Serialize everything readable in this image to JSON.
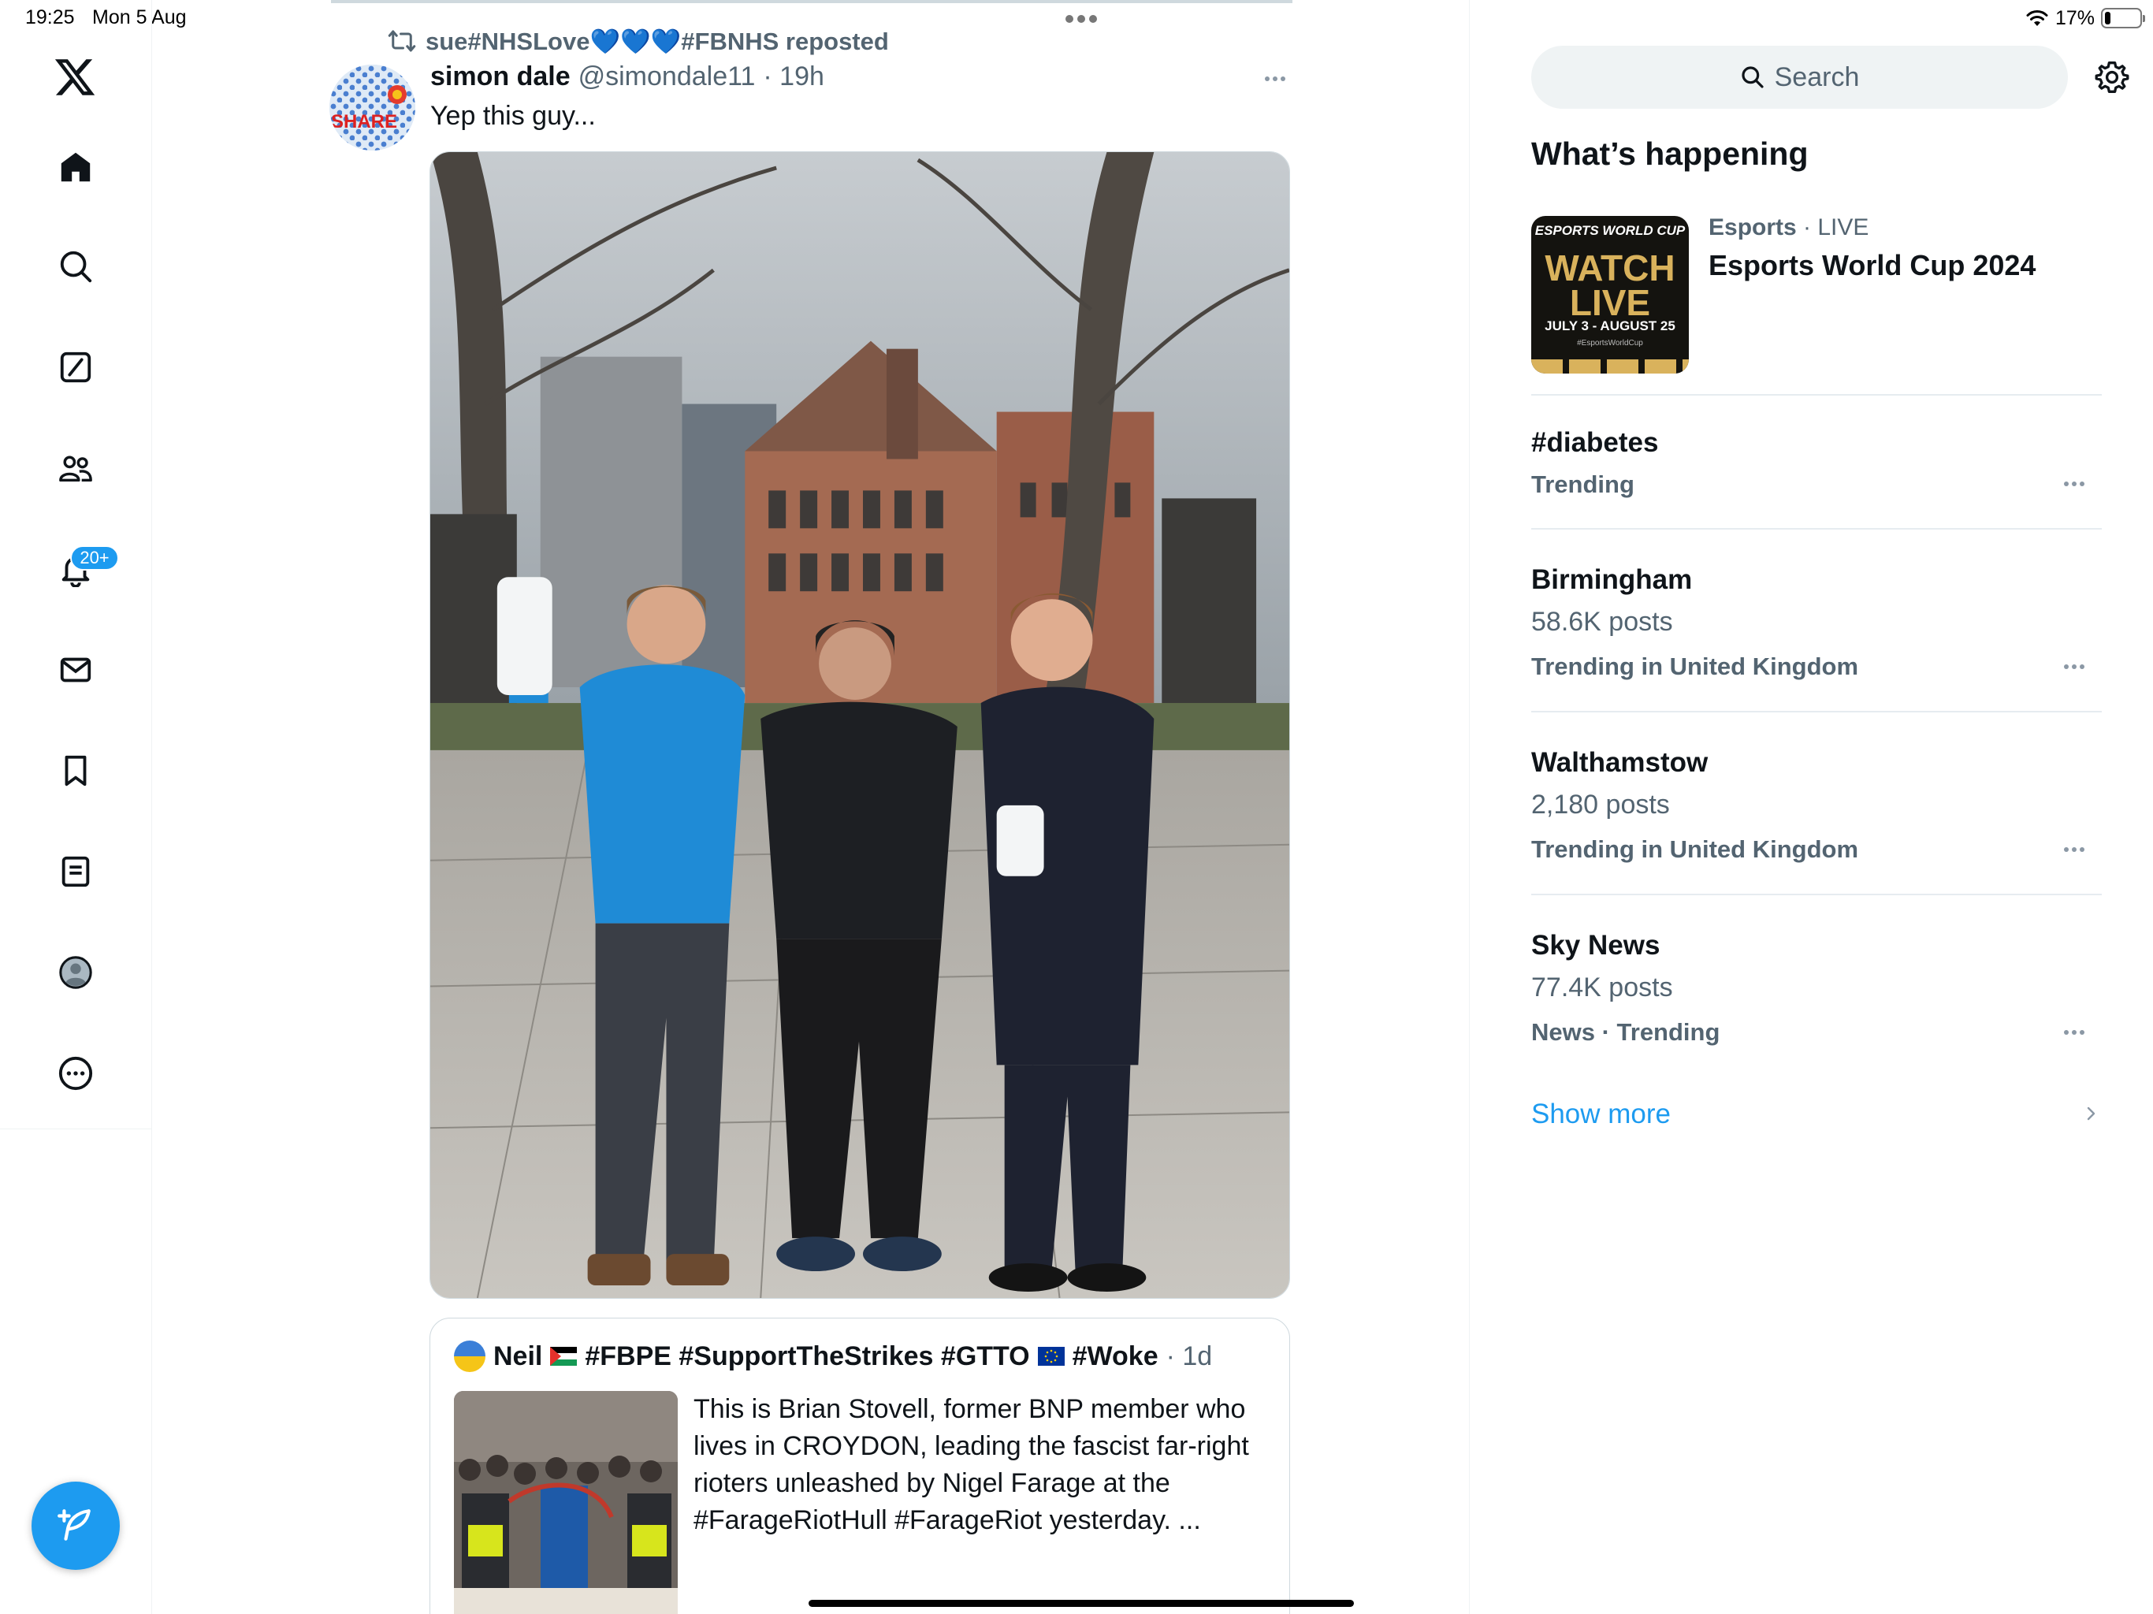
{
  "status_bar": {
    "time": "19:25",
    "date": "Mon 5 Aug",
    "battery": "17%",
    "battery_level": 0.17
  },
  "nav": {
    "items": [
      {
        "name": "home",
        "icon": "home-icon"
      },
      {
        "name": "explore",
        "icon": "search-icon"
      },
      {
        "name": "grok",
        "icon": "slash-box-icon"
      },
      {
        "name": "communities",
        "icon": "people-icon"
      },
      {
        "name": "notifications",
        "icon": "bell-icon"
      },
      {
        "name": "messages",
        "icon": "mail-icon"
      },
      {
        "name": "bookmarks",
        "icon": "bookmark-icon"
      },
      {
        "name": "lists",
        "icon": "list-icon"
      },
      {
        "name": "profile",
        "icon": "profile-icon"
      },
      {
        "name": "more",
        "icon": "more-circle-icon"
      }
    ],
    "notification_badge": "20+",
    "compose_icon": "feather-plus-icon"
  },
  "tweet": {
    "repost_user": "sue#NHSLove",
    "repost_hearts": "💙💙💙",
    "repost_tag": "#FBNHS reposted",
    "author_name": "simon dale",
    "author_handle": "@simondale11",
    "time": "· 19h",
    "text": "Yep this guy..."
  },
  "quote": {
    "name_prefix": "Neil",
    "name_middle": "#FBPE #SupportTheStrikes #GTTO",
    "name_suffix": "#Woke",
    "time": "· 1d",
    "text": "This is Brian Stovell, former BNP member who lives in CROYDON, leading the fascist far-right rioters unleashed by Nigel Farage at the #FarageRiotHull #FarageRiot yesterday. ..."
  },
  "sidebar": {
    "search_placeholder": "Search",
    "section_title": "What’s happening",
    "event": {
      "category": "Esports",
      "status": "· LIVE",
      "title": "Esports World Cup 2024",
      "thumb_brand": "ESPORTS WORLD CUP",
      "thumb_watch": "WATCH LIVE",
      "thumb_dates": "JULY 3 - AUGUST 25",
      "thumb_tag": "#EsportsWorldCup"
    },
    "trends": [
      {
        "name": "#diabetes",
        "posts": "",
        "context": "Trending"
      },
      {
        "name": "Birmingham",
        "posts": "58.6K posts",
        "context": "Trending in United Kingdom"
      },
      {
        "name": "Walthamstow",
        "posts": "2,180 posts",
        "context": "Trending in United Kingdom"
      },
      {
        "name": "Sky News",
        "posts": "77.4K posts",
        "context": "News · Trending"
      }
    ],
    "show_more": "Show more"
  },
  "colors": {
    "accent": "#1d9bf0",
    "text_primary": "#0f1419",
    "text_secondary": "#536471",
    "border": "#cfd9de"
  }
}
